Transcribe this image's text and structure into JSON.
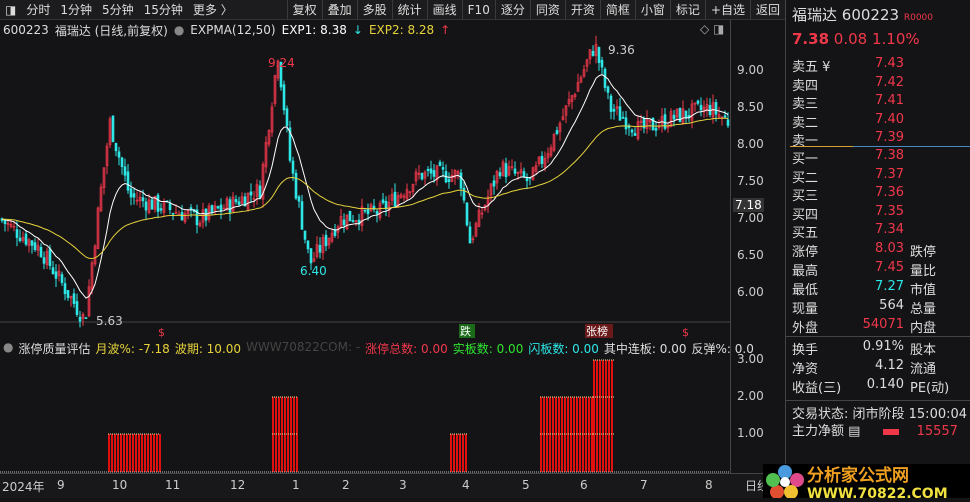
{
  "toolbar": {
    "left": [
      "分时",
      "1分钟",
      "5分钟",
      "15分钟",
      "更多 〉"
    ],
    "buttons": [
      "复权",
      "叠加",
      "多股",
      "统计",
      "画线",
      "F10",
      "逐分",
      "同资",
      "开资",
      "简框",
      "小窗",
      "标记",
      "+自选",
      "返回"
    ]
  },
  "info": {
    "code": "600223",
    "title": "福瑞达 (日线,前复权)",
    "indicator": "EXPMA(12,50)",
    "exp1": "EXP1: 8.38",
    "exp2": "EXP2: 8.28"
  },
  "chart_data": {
    "type": "candlestick",
    "anchors": [
      [
        0,
        7.0
      ],
      [
        40,
        6.6
      ],
      [
        85,
        5.63
      ],
      [
        100,
        7.3
      ],
      [
        110,
        8.3
      ],
      [
        130,
        7.3
      ],
      [
        200,
        7.0
      ],
      [
        260,
        7.4
      ],
      [
        278,
        9.24
      ],
      [
        290,
        7.8
      ],
      [
        310,
        6.4
      ],
      [
        340,
        7.0
      ],
      [
        380,
        7.1
      ],
      [
        420,
        7.6
      ],
      [
        460,
        7.6
      ],
      [
        470,
        6.7
      ],
      [
        500,
        7.7
      ],
      [
        530,
        7.5
      ],
      [
        550,
        8.0
      ],
      [
        570,
        8.6
      ],
      [
        595,
        9.36
      ],
      [
        610,
        8.5
      ],
      [
        640,
        8.2
      ],
      [
        680,
        8.4
      ],
      [
        710,
        8.5
      ],
      [
        730,
        8.3
      ]
    ],
    "price_ticks": [
      "9.00",
      "8.50",
      "8.00",
      "7.50",
      "7.00",
      "6.50",
      "6.00"
    ],
    "current": "7.18",
    "annotations": {
      "high1": "9.24",
      "high2": "9.36",
      "low1": "6.40",
      "low2": "5.63"
    },
    "indicator": {
      "ticks": [
        "3.00",
        "2.00",
        "1.00"
      ],
      "bars": [
        [
          108,
          160,
          1
        ],
        [
          272,
          297,
          2
        ],
        [
          450,
          468,
          1
        ],
        [
          540,
          593,
          2
        ],
        [
          593,
          614,
          3
        ]
      ]
    },
    "x_labels": [
      "2024年",
      "9",
      "10",
      "11",
      "12",
      "1",
      "2",
      "3",
      "4",
      "5",
      "6",
      "7",
      "8"
    ]
  },
  "markers": {
    "s": "$",
    "die": "跌",
    "zhangbang": "张榜"
  },
  "ind": {
    "name": "涨停质量评估",
    "yuebo": "月波%: -7.18",
    "boqi": "波期: 10.00",
    "site": "WWW70822COM: -",
    "zt": "涨停总数: 0.00",
    "sb": "实板数: 0.00",
    "sb2": "闪板数: 0.00",
    "lb": "其中连板: 0.00",
    "ft": "反弹%: 0.0"
  },
  "side": {
    "name": "福瑞达",
    "code": "600223",
    "tag": "R0000",
    "price": "7.38",
    "chg": "0.08",
    "pct": "1.10%",
    "asks": [
      [
        "卖五 ¥",
        "7.43"
      ],
      [
        "卖四",
        "7.42"
      ],
      [
        "卖三",
        "7.41"
      ],
      [
        "卖二",
        "7.40"
      ],
      [
        "卖一",
        "7.39"
      ]
    ],
    "bids": [
      [
        "买一",
        "7.38"
      ],
      [
        "买二",
        "7.37"
      ],
      [
        "买三",
        "7.36"
      ],
      [
        "买四",
        "7.35"
      ],
      [
        "买五",
        "7.34"
      ]
    ],
    "stats": [
      [
        "涨停",
        "8.03",
        "跌停"
      ],
      [
        "最高",
        "7.45",
        "量比"
      ],
      [
        "最低",
        "7.27",
        "市值"
      ],
      [
        "现量",
        "564",
        "总量"
      ],
      [
        "外盘",
        "54071",
        "内盘"
      ]
    ],
    "stats2": [
      [
        "换手",
        "0.91%",
        "股本"
      ],
      [
        "净资",
        "4.12",
        "流通"
      ],
      [
        "收益(三)",
        "0.140",
        "PE(动)"
      ]
    ],
    "status": "交易状态: 闭市阶段 15:00:04",
    "net": "主力净额",
    "net_val": "15557",
    "day": "日线"
  },
  "logo": {
    "cn": "分析家公式网",
    "url": "WWW.70822.COM"
  }
}
